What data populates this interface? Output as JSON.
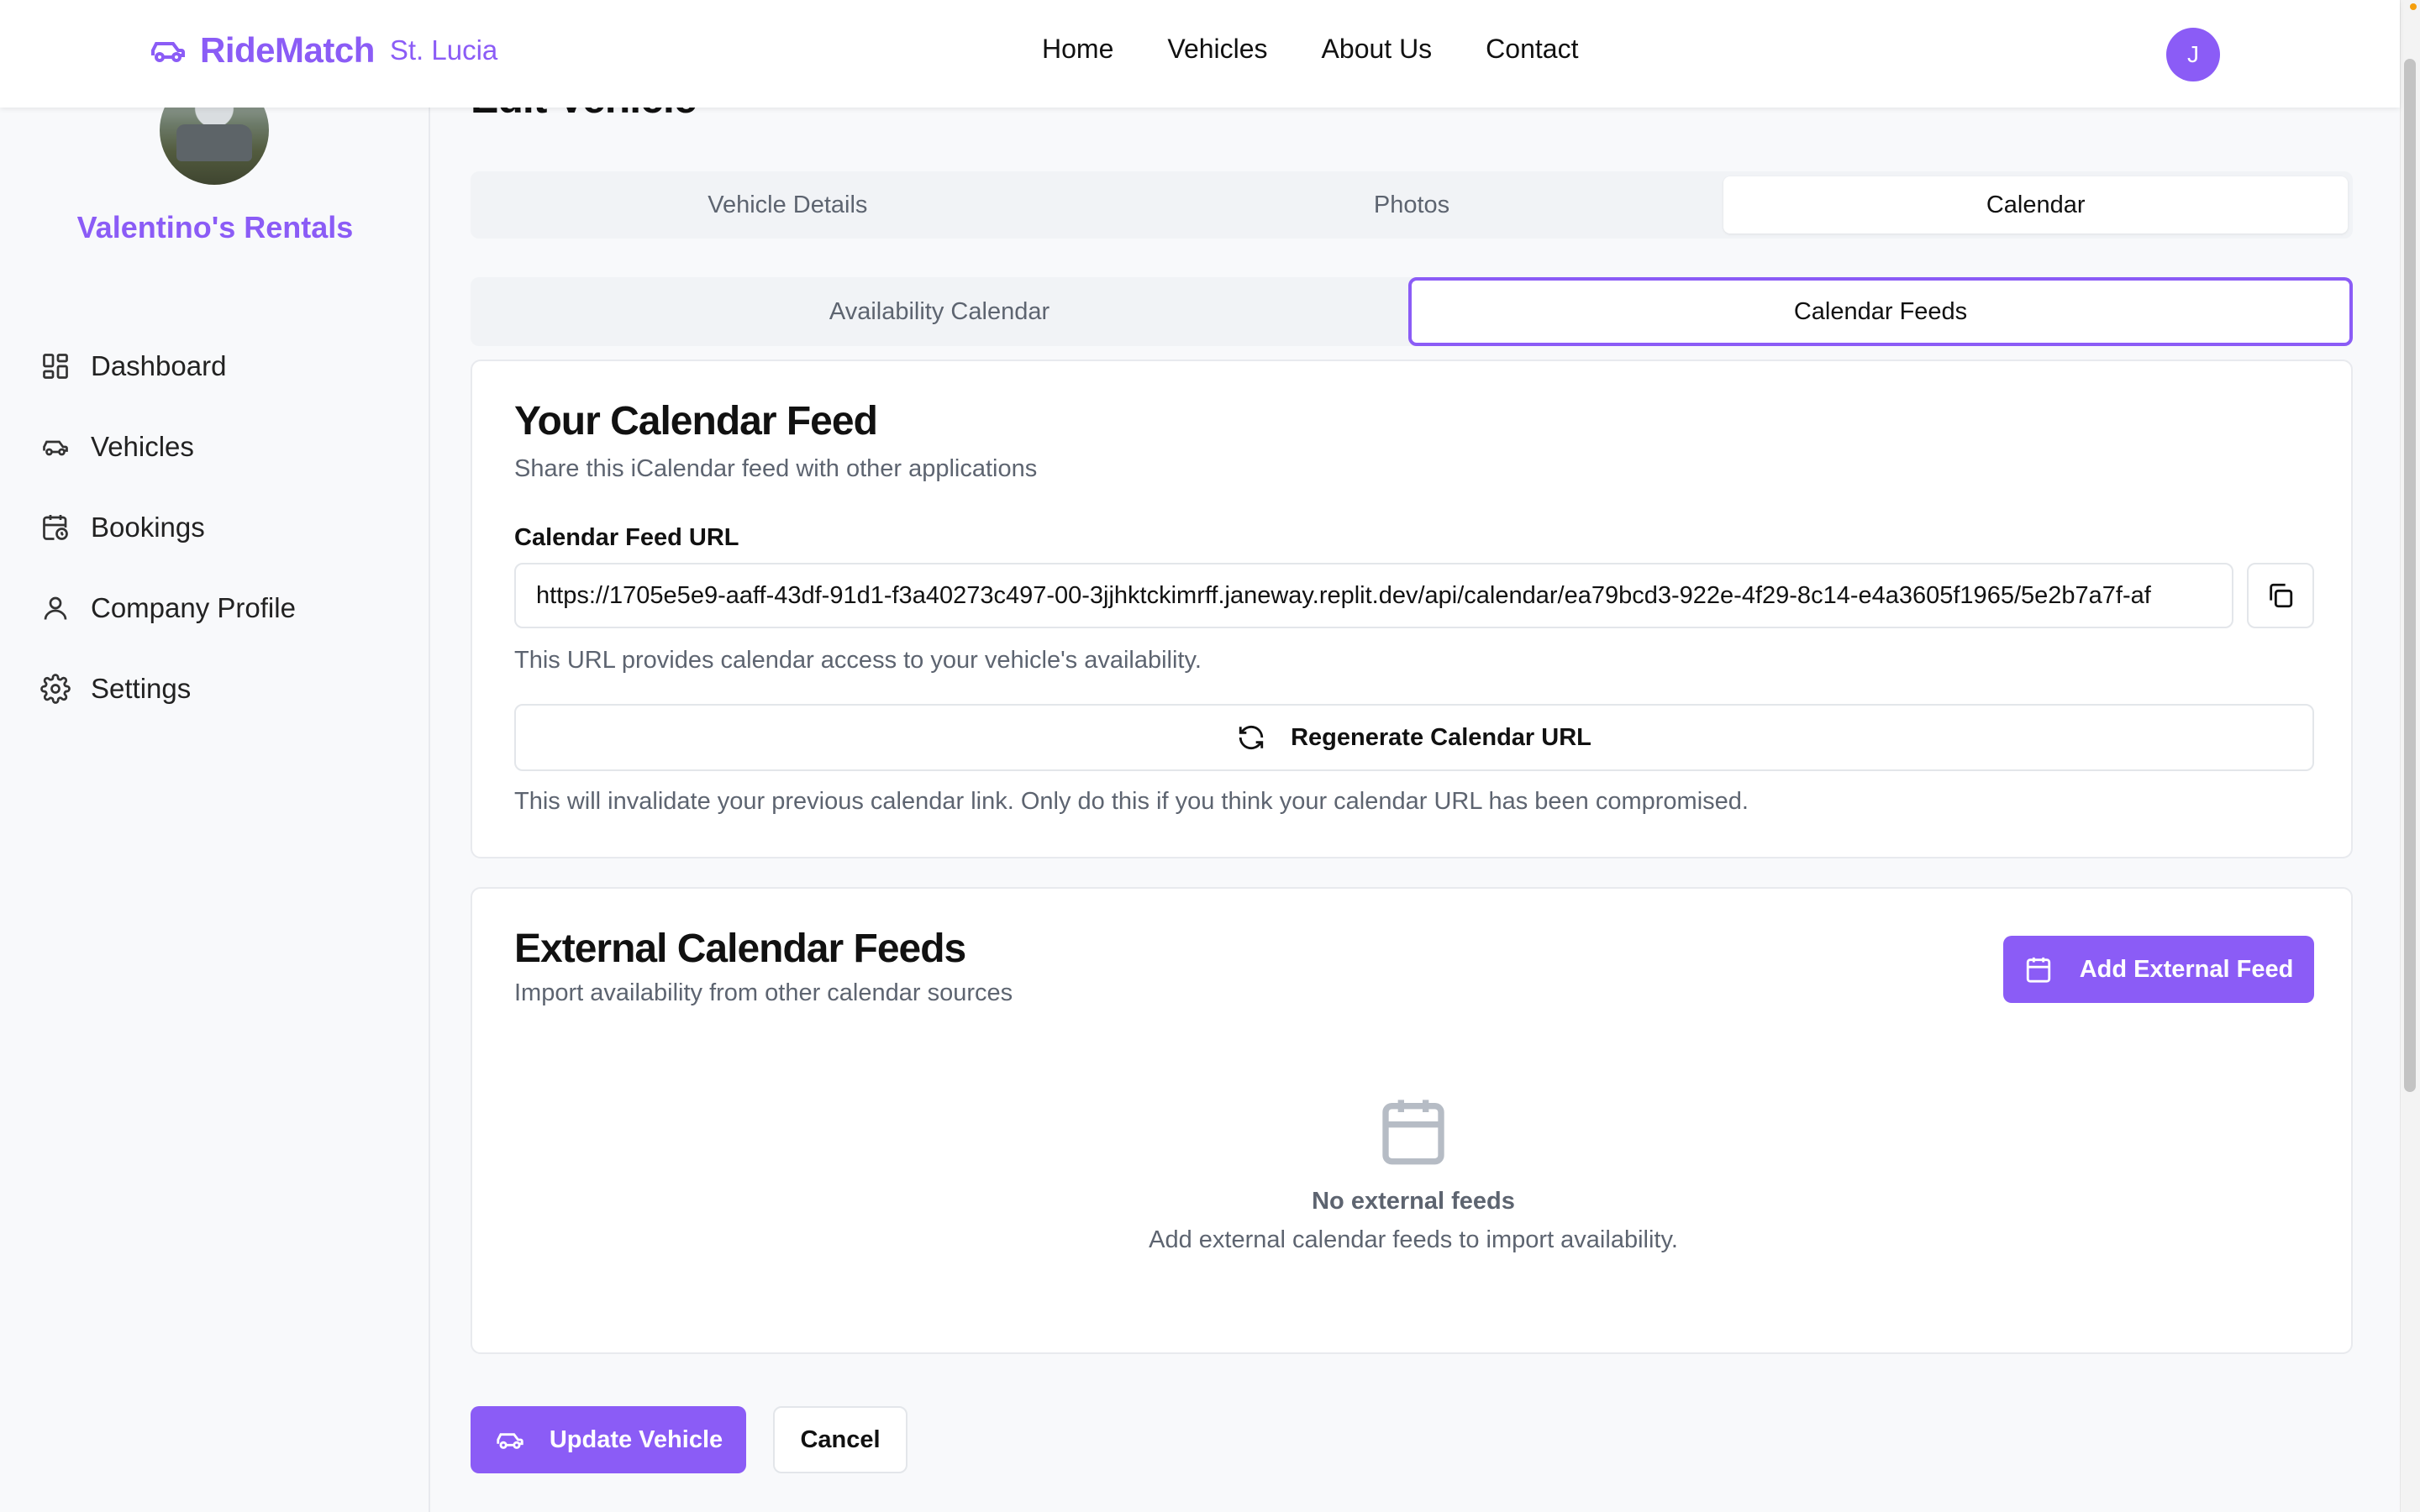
{
  "header": {
    "brand_name": "RideMatch",
    "brand_location": "St. Lucia",
    "nav": [
      "Home",
      "Vehicles",
      "About Us",
      "Contact"
    ],
    "avatar_initial": "J"
  },
  "sidebar": {
    "company_name": "Valentino's Rentals",
    "items": [
      {
        "label": "Dashboard",
        "icon": "dashboard-icon"
      },
      {
        "label": "Vehicles",
        "icon": "car-icon"
      },
      {
        "label": "Bookings",
        "icon": "calendar-clock-icon"
      },
      {
        "label": "Company Profile",
        "icon": "user-icon"
      },
      {
        "label": "Settings",
        "icon": "gear-icon"
      }
    ]
  },
  "page": {
    "title": "Edit Vehicle",
    "tabs": [
      "Vehicle Details",
      "Photos",
      "Calendar"
    ],
    "active_tab": "Calendar",
    "subtabs": [
      "Availability Calendar",
      "Calendar Feeds"
    ],
    "active_subtab": "Calendar Feeds"
  },
  "feed_card": {
    "title": "Your Calendar Feed",
    "subtitle": "Share this iCalendar feed with other applications",
    "url_label": "Calendar Feed URL",
    "url_value": "https://1705e5e9-aaff-43df-91d1-f3a40273c497-00-3jjhktckimrff.janeway.replit.dev/api/calendar/ea79bcd3-922e-4f29-8c14-e4a3605f1965/5e2b7a7f-af",
    "url_hint": "This URL provides calendar access to your vehicle's availability.",
    "regenerate_label": "Regenerate Calendar URL",
    "regenerate_hint": "This will invalidate your previous calendar link. Only do this if you think your calendar URL has been compromised."
  },
  "external_card": {
    "title": "External Calendar Feeds",
    "subtitle": "Import availability from other calendar sources",
    "add_button": "Add External Feed",
    "empty_title": "No external feeds",
    "empty_subtitle": "Add external calendar feeds to import availability."
  },
  "actions": {
    "update_label": "Update Vehicle",
    "cancel_label": "Cancel"
  },
  "colors": {
    "accent": "#8b5cf6",
    "muted_text": "#5d6470",
    "background": "#f8f9fb"
  }
}
